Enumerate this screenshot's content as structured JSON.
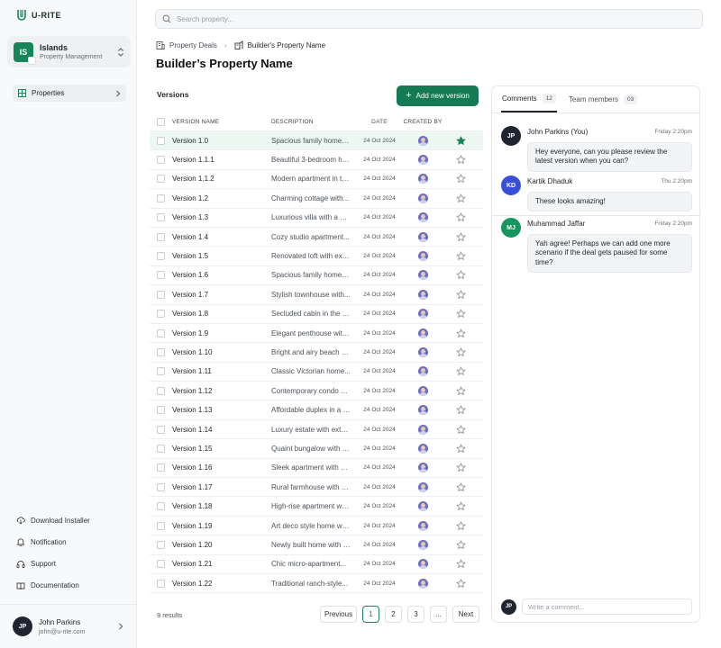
{
  "brand": {
    "name": "U-RITE"
  },
  "workspace": {
    "initials": "IS",
    "name": "Islands",
    "role": "Property Management"
  },
  "nav": {
    "properties": "Properties"
  },
  "side_links": [
    {
      "label": "Download Installer",
      "icon": "download-cloud-icon"
    },
    {
      "label": "Notification",
      "icon": "bell-icon"
    },
    {
      "label": "Support",
      "icon": "headset-icon"
    },
    {
      "label": "Documentation",
      "icon": "book-icon"
    }
  ],
  "user": {
    "initials": "JP",
    "name": "John Parkins",
    "email": "john@u-rite.com"
  },
  "search": {
    "placeholder": "Search property..."
  },
  "breadcrumb": {
    "parent": "Property Deals",
    "current": "Builder's Property Name"
  },
  "page_title": "Builder’s Property Name",
  "versions": {
    "title": "Versions",
    "add_label": "Add new version",
    "columns": {
      "name": "VERSION NAME",
      "description": "DESCRIPTION",
      "date": "DATE",
      "created_by": "CREATED BY"
    },
    "rows": [
      {
        "name": "Version 1.0",
        "description": "Spacious family home i...",
        "date": "24 Oct 2024",
        "starred": true,
        "selected": true
      },
      {
        "name": "Version 1.1.1",
        "description": "Beautiful 3-bedroom ho...",
        "date": "24 Oct 2024",
        "starred": false
      },
      {
        "name": "Version 1.1.2",
        "description": "Modern apartment in th...",
        "date": "24 Oct 2024",
        "starred": false
      },
      {
        "name": "Version 1.2",
        "description": "Charming cottage with...",
        "date": "24 Oct 2024",
        "starred": false
      },
      {
        "name": "Version 1.3",
        "description": "Luxurious villa with a po...",
        "date": "24 Oct 2024",
        "starred": false
      },
      {
        "name": "Version 1.4",
        "description": "Cozy studio apartment...",
        "date": "24 Oct 2024",
        "starred": false
      },
      {
        "name": "Version 1.5",
        "description": "Renovated loft with exp...",
        "date": "24 Oct 2024",
        "starred": false
      },
      {
        "name": "Version 1.6",
        "description": "Spacious family home i...",
        "date": "24 Oct 2024",
        "starred": false
      },
      {
        "name": "Version 1.7",
        "description": "Stylish townhouse with...",
        "date": "24 Oct 2024",
        "starred": false
      },
      {
        "name": "Version 1.8",
        "description": "Secluded cabin in the w...",
        "date": "24 Oct 2024",
        "starred": false
      },
      {
        "name": "Version 1.9",
        "description": "Elegant penthouse with...",
        "date": "24 Oct 2024",
        "starred": false
      },
      {
        "name": "Version 1.10",
        "description": "Bright and airy beach h...",
        "date": "24 Oct 2024",
        "starred": false
      },
      {
        "name": "Version 1.11",
        "description": "Classic Victorian home...",
        "date": "24 Oct 2024",
        "starred": false
      },
      {
        "name": "Version 1.12",
        "description": "Contemporary condo w...",
        "date": "24 Oct 2024",
        "starred": false
      },
      {
        "name": "Version 1.13",
        "description": "Affordable duplex in a f...",
        "date": "24 Oct 2024",
        "starred": false
      },
      {
        "name": "Version 1.14",
        "description": "Luxury estate with exte...",
        "date": "24 Oct 2024",
        "starred": false
      },
      {
        "name": "Version 1.15",
        "description": "Quaint bungalow with a...",
        "date": "24 Oct 2024",
        "starred": false
      },
      {
        "name": "Version 1.16",
        "description": "Sleek apartment with m...",
        "date": "24 Oct 2024",
        "starred": false
      },
      {
        "name": "Version 1.17",
        "description": "Rural farmhouse with e...",
        "date": "24 Oct 2024",
        "starred": false
      },
      {
        "name": "Version 1.18",
        "description": "High-rise apartment wit...",
        "date": "24 Oct 2024",
        "starred": false
      },
      {
        "name": "Version 1.19",
        "description": "Art deco style home wit...",
        "date": "24 Oct 2024",
        "starred": false
      },
      {
        "name": "Version 1.20",
        "description": "Newly built home with e...",
        "date": "24 Oct 2024",
        "starred": false
      },
      {
        "name": "Version 1.21",
        "description": "Chic micro-apartment...",
        "date": "24 Oct 2024",
        "starred": false
      },
      {
        "name": "Version 1.22",
        "description": "Traditional ranch-style...",
        "date": "24 Oct 2024",
        "starred": false
      }
    ],
    "results": "9 results"
  },
  "pagination": {
    "previous": "Previous",
    "pages": [
      "1",
      "2",
      "3",
      "..."
    ],
    "active": "1",
    "next": "Next"
  },
  "comments_panel": {
    "tabs": [
      {
        "label": "Comments",
        "count": "12"
      },
      {
        "label": "Team members",
        "count": "03"
      }
    ],
    "comments": [
      {
        "initials": "JP",
        "name": "John Parkins (You)",
        "time": "Friday 2:20pm",
        "text": "Hey everyone, can you please review the latest version when you can?",
        "color": "#1e2530"
      },
      {
        "initials": "KD",
        "name": "Kartik Dhaduk",
        "time": "Thu 2:20pm",
        "text": "These looks amazing!",
        "color": "#3a4fd8"
      },
      {
        "initials": "MJ",
        "name": "Muhammad Jaffar",
        "time": "Friday 2:20pm",
        "text": "Yah agree! Perhaps we can add one more scenario if the deal gets paused for some time?",
        "color": "#17955e"
      }
    ],
    "composer": {
      "initials": "JP",
      "placeholder": "Write a comment..."
    }
  },
  "colors": {
    "accent": "#147a53",
    "star": "#17855b"
  }
}
